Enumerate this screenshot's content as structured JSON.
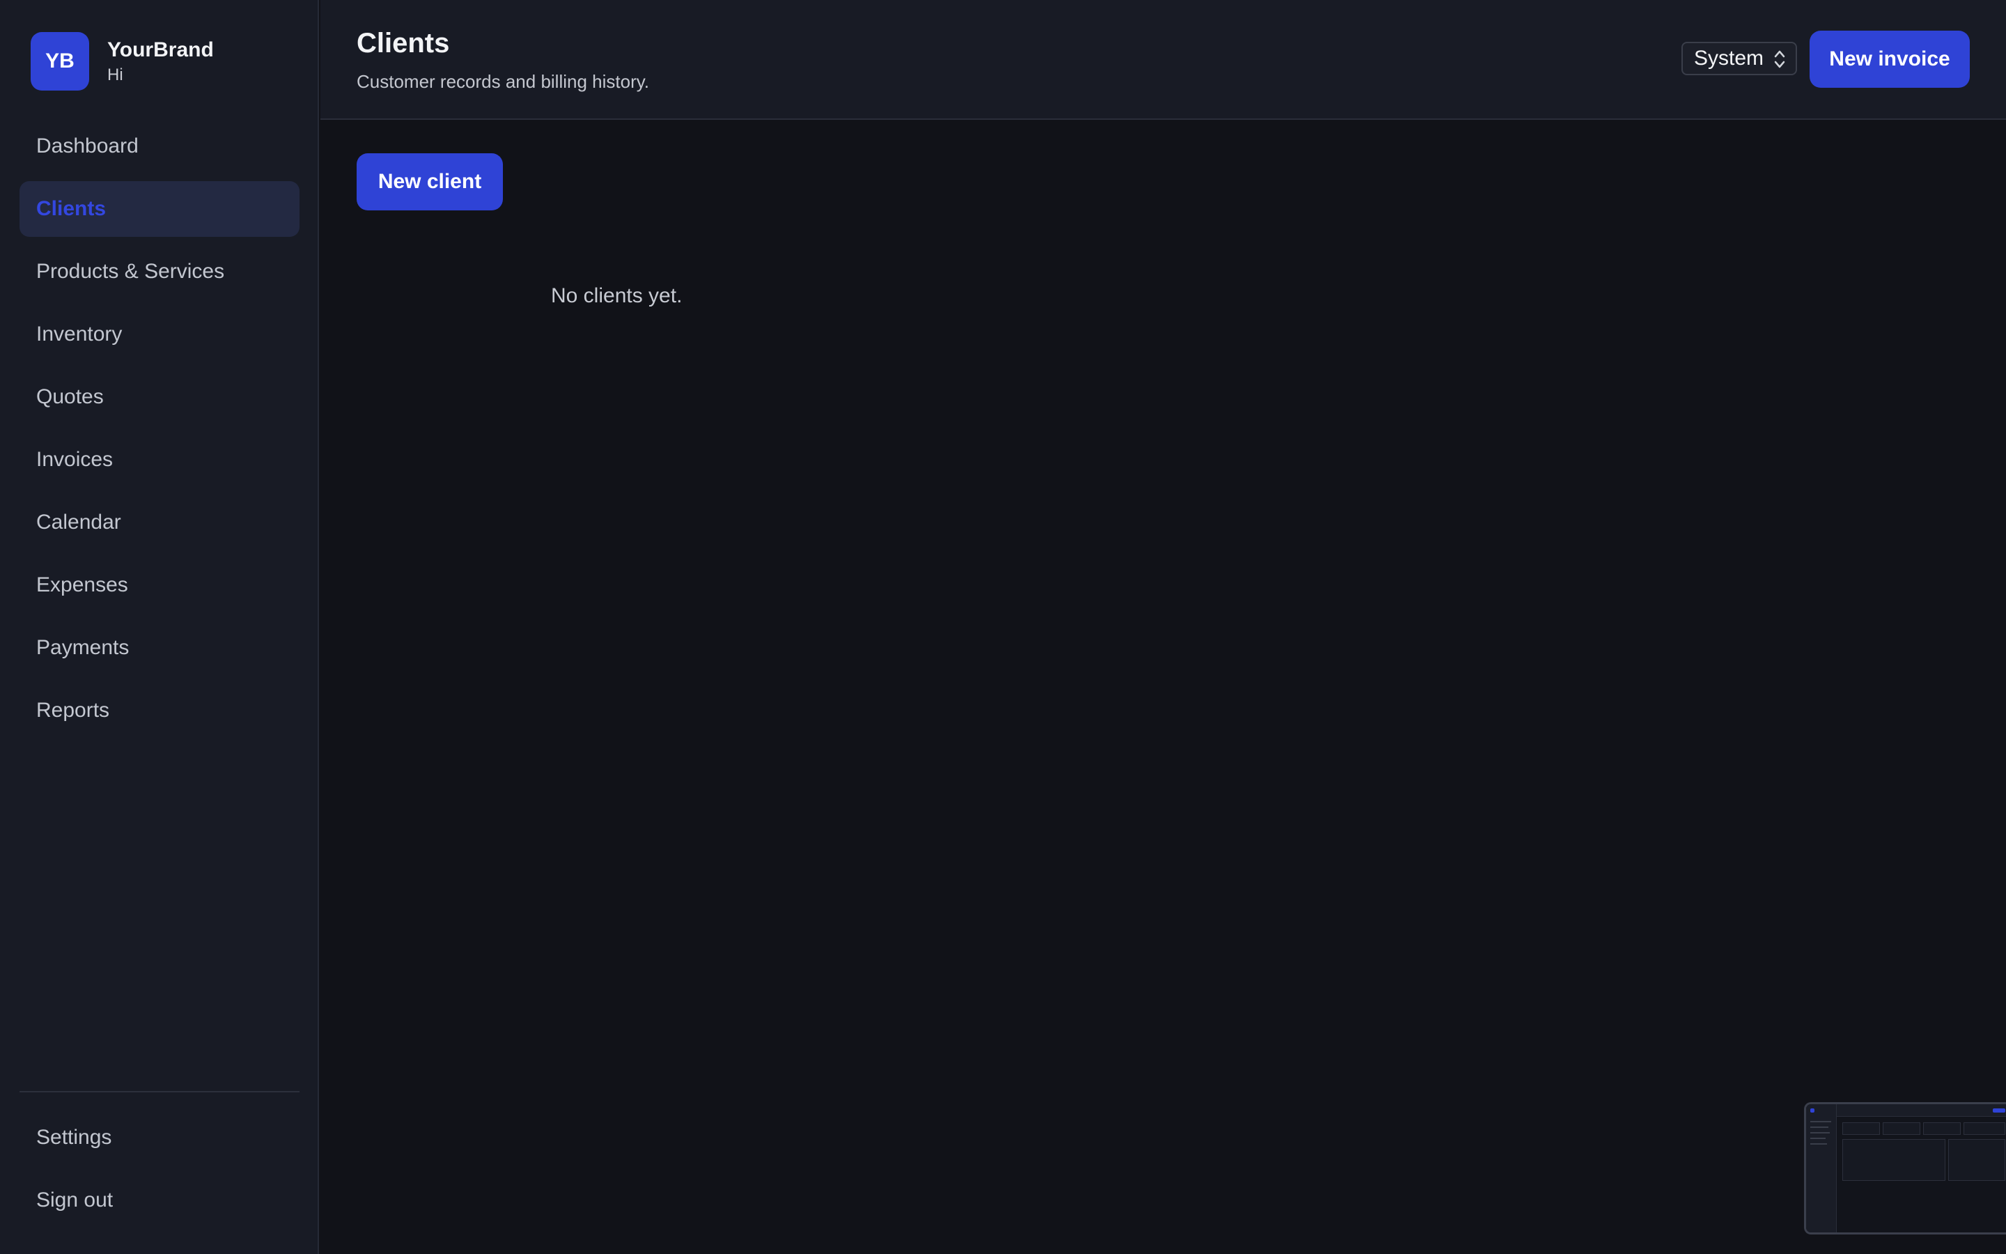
{
  "brand": {
    "logo_text": "YB",
    "name": "YourBrand",
    "greeting": "Hi"
  },
  "sidebar": {
    "items": [
      {
        "label": "Dashboard",
        "active": false
      },
      {
        "label": "Clients",
        "active": true
      },
      {
        "label": "Products & Services",
        "active": false
      },
      {
        "label": "Inventory",
        "active": false
      },
      {
        "label": "Quotes",
        "active": false
      },
      {
        "label": "Invoices",
        "active": false
      },
      {
        "label": "Calendar",
        "active": false
      },
      {
        "label": "Expenses",
        "active": false
      },
      {
        "label": "Payments",
        "active": false
      },
      {
        "label": "Reports",
        "active": false
      }
    ],
    "bottom_items": [
      {
        "label": "Settings"
      },
      {
        "label": "Sign out"
      }
    ]
  },
  "header": {
    "title": "Clients",
    "subtitle": "Customer records and billing history.",
    "theme_select": {
      "value": "System"
    },
    "new_invoice_label": "New invoice"
  },
  "main": {
    "new_client_label": "New client",
    "empty_message": "No clients yet."
  },
  "colors": {
    "accent": "#2f43d6",
    "background": "#111218",
    "sidebar": "#181b25",
    "active_item_bg": "#232942"
  }
}
